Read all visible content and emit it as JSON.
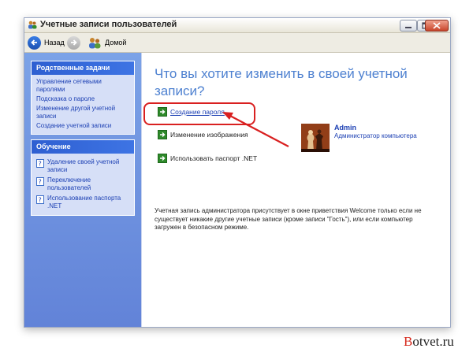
{
  "window": {
    "title": "Учетные записи пользователей"
  },
  "toolbar": {
    "back_label": "Назад",
    "home_label": "Домой"
  },
  "sidebar": {
    "related": {
      "title": "Родственные задачи",
      "links": [
        "Управление сетевыми паролями",
        "Подсказка о пароле",
        "Изменение другой учетной записи",
        "Создание учетной записи"
      ]
    },
    "learn": {
      "title": "Обучение",
      "items": [
        "Удаление своей учетной записи",
        "Переключение пользователей",
        "Использование паспорта .NET"
      ]
    }
  },
  "main": {
    "heading": "Что вы хотите изменить в своей учетной записи?",
    "tasks": [
      "Создание пароля",
      "Изменение изображения",
      "Использовать паспорт .NET"
    ],
    "account": {
      "name": "Admin",
      "role": "Администратор компьютера"
    },
    "info": "Учетная запись администратора присутствует в окне приветствия Welcome только если не существует никакие другие учетные записи (кроме записи \"Гость\"), или если компьютер загружен в безопасном режиме."
  },
  "watermark": {
    "first": "B",
    "rest": "otvet.ru"
  },
  "colors": {
    "accent_red": "#d92020",
    "sidebar_blue": "#6f93df",
    "link_blue": "#1b3fb3",
    "task_green": "#2f8a2b"
  }
}
